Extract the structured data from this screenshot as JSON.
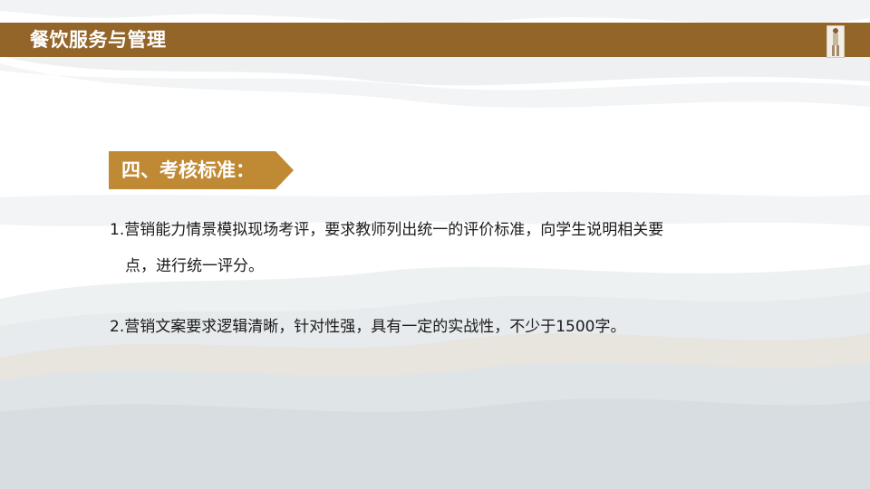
{
  "header": {
    "title": "餐饮服务与管理"
  },
  "section": {
    "title": "四、考核标准："
  },
  "content": {
    "item1_line1": "1.营销能力情景模拟现场考评，要求教师列出统一的评价标准，向学生说明相关要",
    "item1_line2": "点，进行统一评分。",
    "item2": "2.营销文案要求逻辑清晰，针对性强，具有一定的实战性，不少于1500字。"
  },
  "colors": {
    "header_bar": "#946529",
    "section_tag": "#c08a35",
    "wave_light": "#eef0f1",
    "wave_mid": "#dde2e5",
    "wave_warm": "#e8e3dc"
  }
}
